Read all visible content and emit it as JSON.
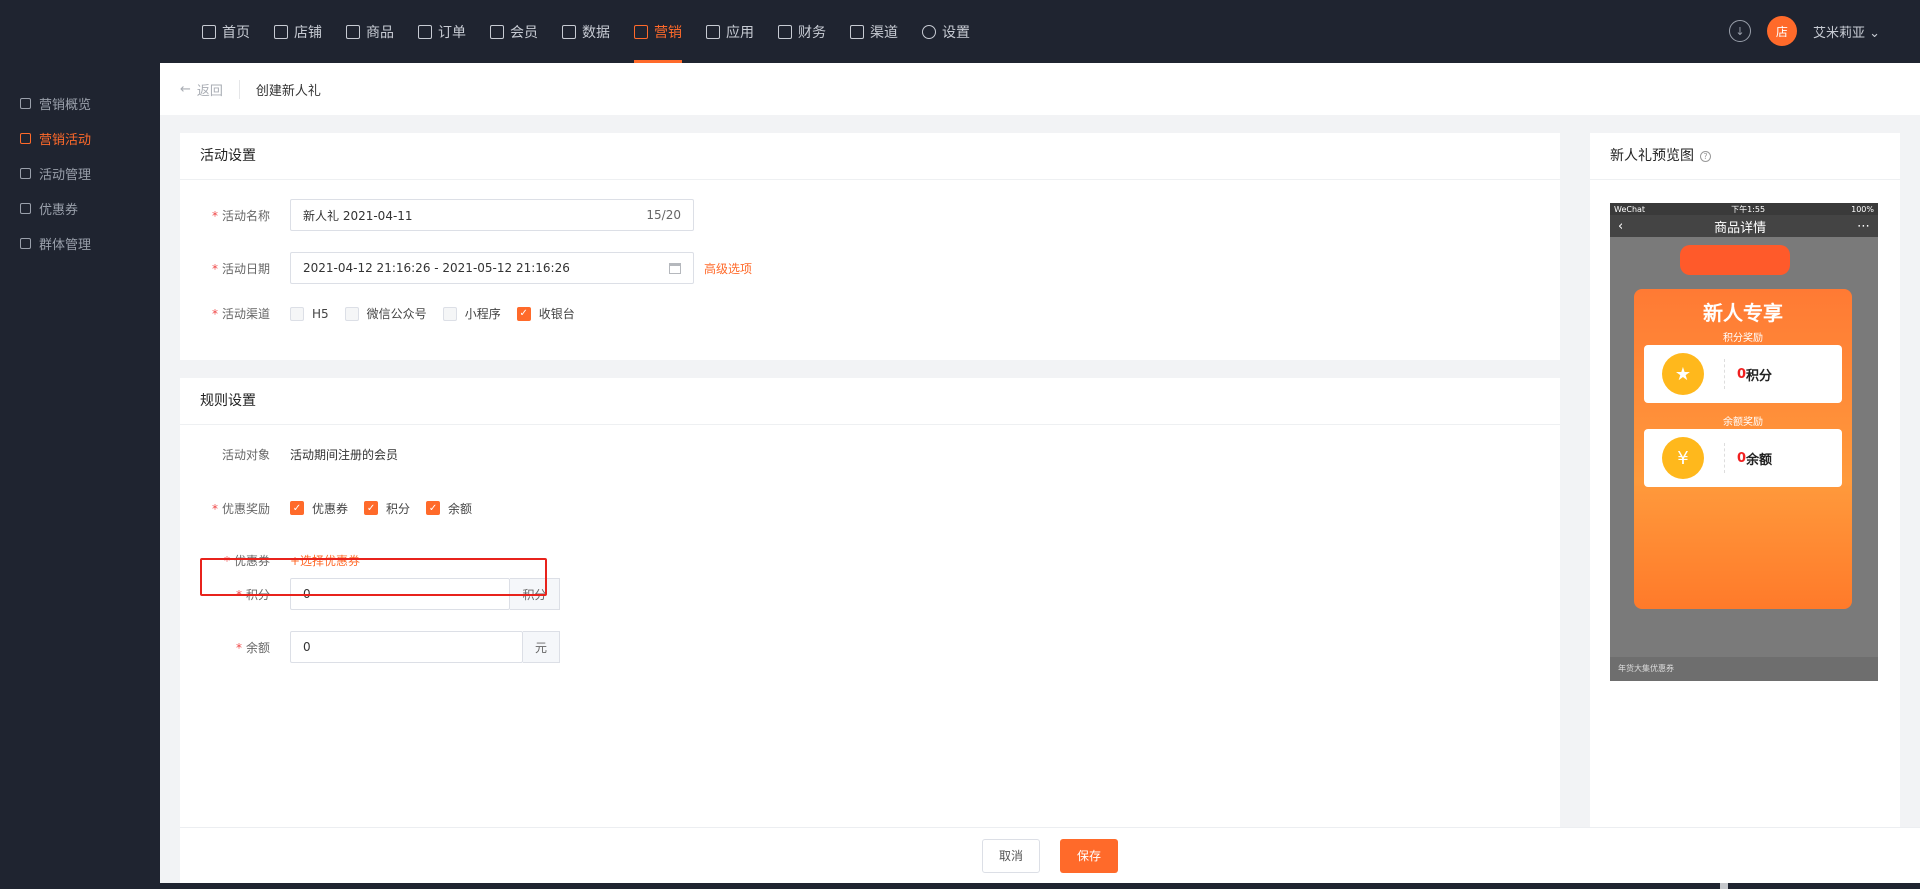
{
  "nav": {
    "items": [
      {
        "label": "首页",
        "icon": "home-icon"
      },
      {
        "label": "店铺",
        "icon": "store-icon"
      },
      {
        "label": "商品",
        "icon": "goods-icon"
      },
      {
        "label": "订单",
        "icon": "order-icon"
      },
      {
        "label": "会员",
        "icon": "member-icon"
      },
      {
        "label": "数据",
        "icon": "chart-icon"
      },
      {
        "label": "营销",
        "icon": "tag-icon",
        "active": true
      },
      {
        "label": "应用",
        "icon": "app-icon"
      },
      {
        "label": "财务",
        "icon": "finance-icon"
      },
      {
        "label": "渠道",
        "icon": "channel-icon"
      },
      {
        "label": "设置",
        "icon": "gear-icon"
      }
    ],
    "user_name": "艾米莉亚",
    "avatar_text": "店"
  },
  "sidebar": {
    "items": [
      {
        "label": "营销概览"
      },
      {
        "label": "营销活动",
        "active": true
      },
      {
        "label": "活动管理"
      },
      {
        "label": "优惠券"
      },
      {
        "label": "群体管理"
      }
    ]
  },
  "breadcrumb": {
    "back": "返回",
    "title": "创建新人礼"
  },
  "activity": {
    "header": "活动设置",
    "name_label": "活动名称",
    "name_value": "新人礼  2021-04-11",
    "name_count": "15/20",
    "date_label": "活动日期",
    "date_value": "2021-04-12 21:16:26 - 2021-05-12 21:16:26",
    "advanced_link": "高级选项",
    "channel_label": "活动渠道",
    "channels": [
      {
        "label": "H5",
        "checked": false
      },
      {
        "label": "微信公众号",
        "checked": false
      },
      {
        "label": "小程序",
        "checked": false
      },
      {
        "label": "收银台",
        "checked": true
      }
    ]
  },
  "rules": {
    "header": "规则设置",
    "target_label": "活动对象",
    "target_value": "活动期间注册的会员",
    "reward_label": "优惠奖励",
    "rewards": [
      {
        "label": "优惠券",
        "checked": true
      },
      {
        "label": "积分",
        "checked": true
      },
      {
        "label": "余额",
        "checked": true
      }
    ],
    "coupon_label": "优惠券",
    "coupon_link": "+选择优惠券",
    "points_label": "积分",
    "points_value": "0",
    "points_unit": "积分",
    "balance_label": "余额",
    "balance_value": "0",
    "balance_unit": "元"
  },
  "footer": {
    "cancel": "取消",
    "save": "保存"
  },
  "preview": {
    "header": "新人礼预览图",
    "status_left": "WeChat",
    "status_mid": "下午1:55",
    "status_right": "100%",
    "page_title": "商品详情",
    "card_title": "新人专享",
    "points_section": "积分奖励",
    "points_amount": "0",
    "points_text": "积分",
    "balance_section": "余额奖励",
    "balance_amount": "0",
    "balance_text": "余额",
    "bottom_text": "年货大集优惠券"
  },
  "colors": {
    "accent": "#ff6a2a",
    "nav_bg": "#1f2430",
    "highlight": "#e8231c"
  }
}
